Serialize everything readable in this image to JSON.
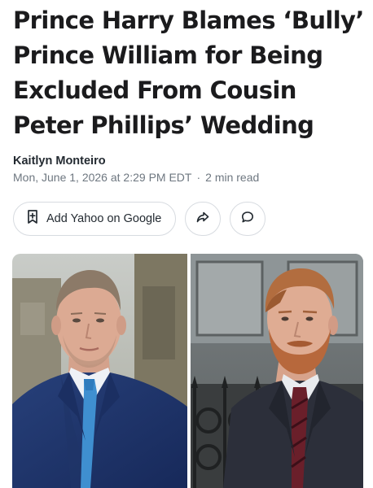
{
  "article": {
    "headline_lines": [
      "Prince Harry Blames ‘Bully’",
      "Prince William for Being",
      "Excluded From Cousin",
      "Peter Phillips’ Wedding"
    ],
    "author": "Kaitlyn Monteiro",
    "published": "Mon, June 1, 2026 at 2:29 PM EDT",
    "separator": "·",
    "read_time": "2 min read"
  },
  "actions": {
    "add_source_label": "Add Yahoo on Google",
    "add_source_icon": "add-bookmark-icon",
    "share_icon": "share-arrow-icon",
    "comment_icon": "comment-bubble-icon"
  },
  "images": [
    {
      "subject": "prince-william",
      "icon": "photo-left"
    },
    {
      "subject": "prince-harry",
      "icon": "photo-right"
    }
  ],
  "colors": {
    "headline": "#1b1b1d",
    "meta": "#6e7780",
    "border": "#d7dbe0"
  }
}
